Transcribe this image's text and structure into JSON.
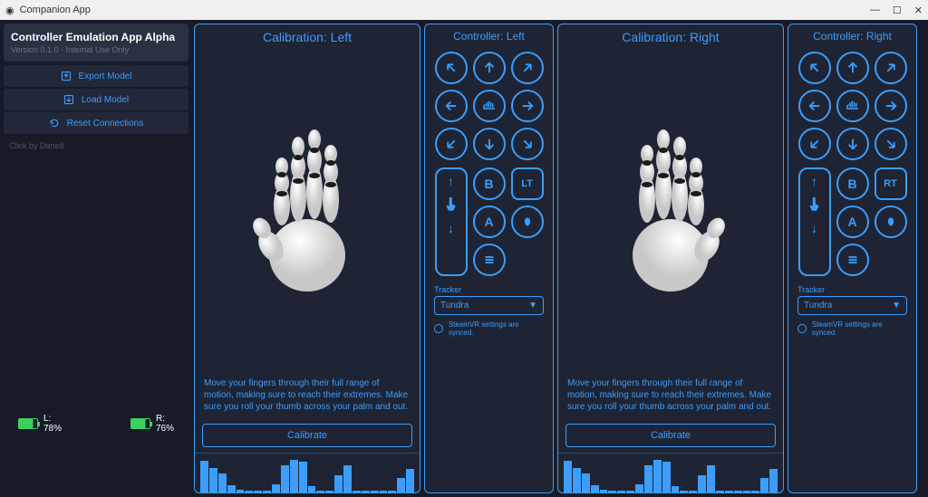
{
  "window": {
    "title": "Companion App"
  },
  "sidebar": {
    "title": "Controller Emulation App Alpha",
    "subtitle": "Version 0.1.0 - Internal Use Only",
    "buttons": {
      "export": "Export Model",
      "load": "Load Model",
      "reset": "Reset Connections"
    },
    "note": "Click by Dane8"
  },
  "battery": {
    "left_label": "L:",
    "left_pct": "78%",
    "right_label": "R:",
    "right_pct": "76%"
  },
  "calibration": {
    "left_title": "Calibration: Left",
    "right_title": "Calibration: Right",
    "instruction": "Move your fingers through their full range of motion, making sure to reach their extremes. Make sure you roll your thumb across your palm and out.",
    "calibrate_label": "Calibrate"
  },
  "controller": {
    "left_title": "Controller: Left",
    "right_title": "Controller: Right",
    "btn_b": "B",
    "btn_a": "A",
    "trigger_left": "LT",
    "trigger_right": "RT",
    "tracker_label": "Tracker",
    "tracker_value": "Tundra",
    "sync_text": "SteamVR settings are synced."
  },
  "chart_data": [
    {
      "type": "bar",
      "title": "Left hand joint calibration signal",
      "xlabel": "",
      "ylabel": "",
      "ylim": [
        0,
        100
      ],
      "values": [
        90,
        70,
        55,
        20,
        8,
        5,
        5,
        5,
        22,
        78,
        92,
        88,
        18,
        5,
        5,
        50,
        78,
        5,
        5,
        5,
        5,
        5,
        42,
        66
      ]
    },
    {
      "type": "bar",
      "title": "Right hand joint calibration signal",
      "xlabel": "",
      "ylabel": "",
      "ylim": [
        0,
        100
      ],
      "values": [
        90,
        70,
        55,
        20,
        8,
        5,
        5,
        5,
        22,
        78,
        92,
        88,
        18,
        5,
        5,
        50,
        78,
        5,
        5,
        5,
        5,
        5,
        42,
        66
      ]
    }
  ]
}
